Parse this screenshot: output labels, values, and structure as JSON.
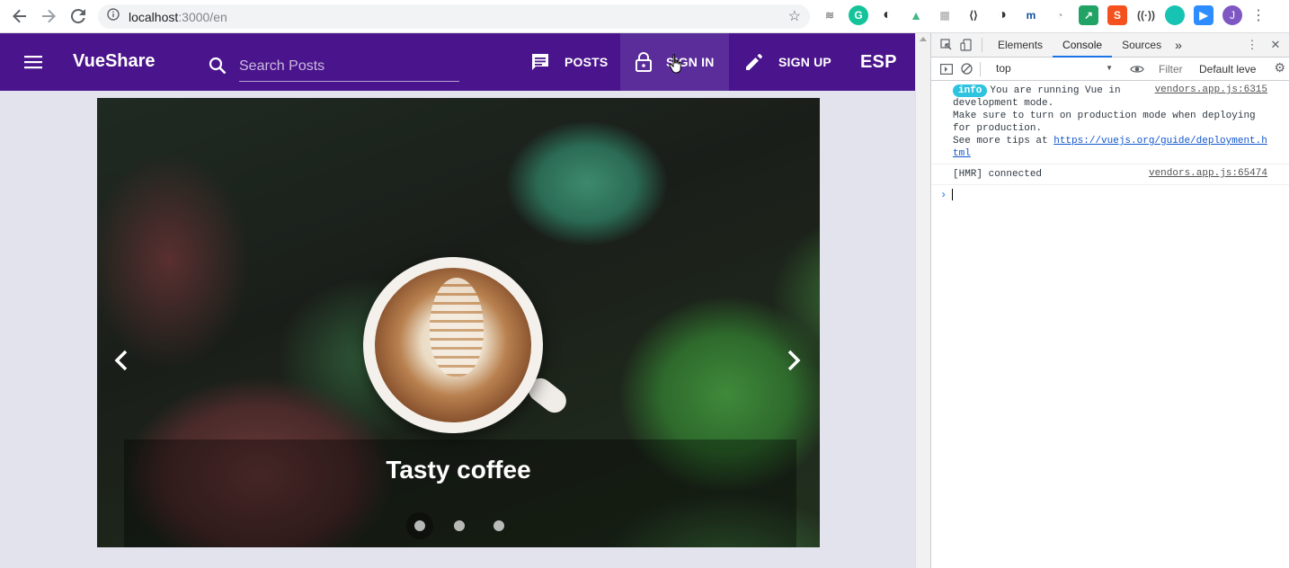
{
  "browser": {
    "url_host": "localhost",
    "url_rest": ":3000/en",
    "profile_initial": "J"
  },
  "app": {
    "brand": "VueShare",
    "search_placeholder": "Search Posts",
    "nav": {
      "posts": "POSTS",
      "sign_in": "SIGN IN",
      "sign_up": "SIGN UP",
      "language": "ESP"
    },
    "carousel": {
      "caption": "Tasty coffee",
      "slide_count": 3,
      "active_slide": 1
    }
  },
  "devtools": {
    "tabs": [
      "Elements",
      "Console",
      "Sources"
    ],
    "active_tab": "Console",
    "more": "»",
    "context": "top",
    "filter_placeholder": "Filter",
    "levels": "Default leve",
    "logs": [
      {
        "badge": "info",
        "line1": "You are running Vue in",
        "line2": "development mode.",
        "line3": "Make sure to turn on production mode when deploying",
        "line4": "for production.",
        "line5_prefix": "See more tips at ",
        "link_a": "https://vuejs.org/guide/deployment.h",
        "link_b": "tml",
        "source": "vendors.app.js:6315"
      },
      {
        "text": "[HMR] connected",
        "source": "vendors.app.js:65474"
      }
    ],
    "prompt": "›"
  },
  "colors": {
    "toolbar": "#4a148c",
    "active_nav": "#5a2d9a",
    "page_bg": "#e3e3ee",
    "info_badge": "#2ec4e0"
  }
}
